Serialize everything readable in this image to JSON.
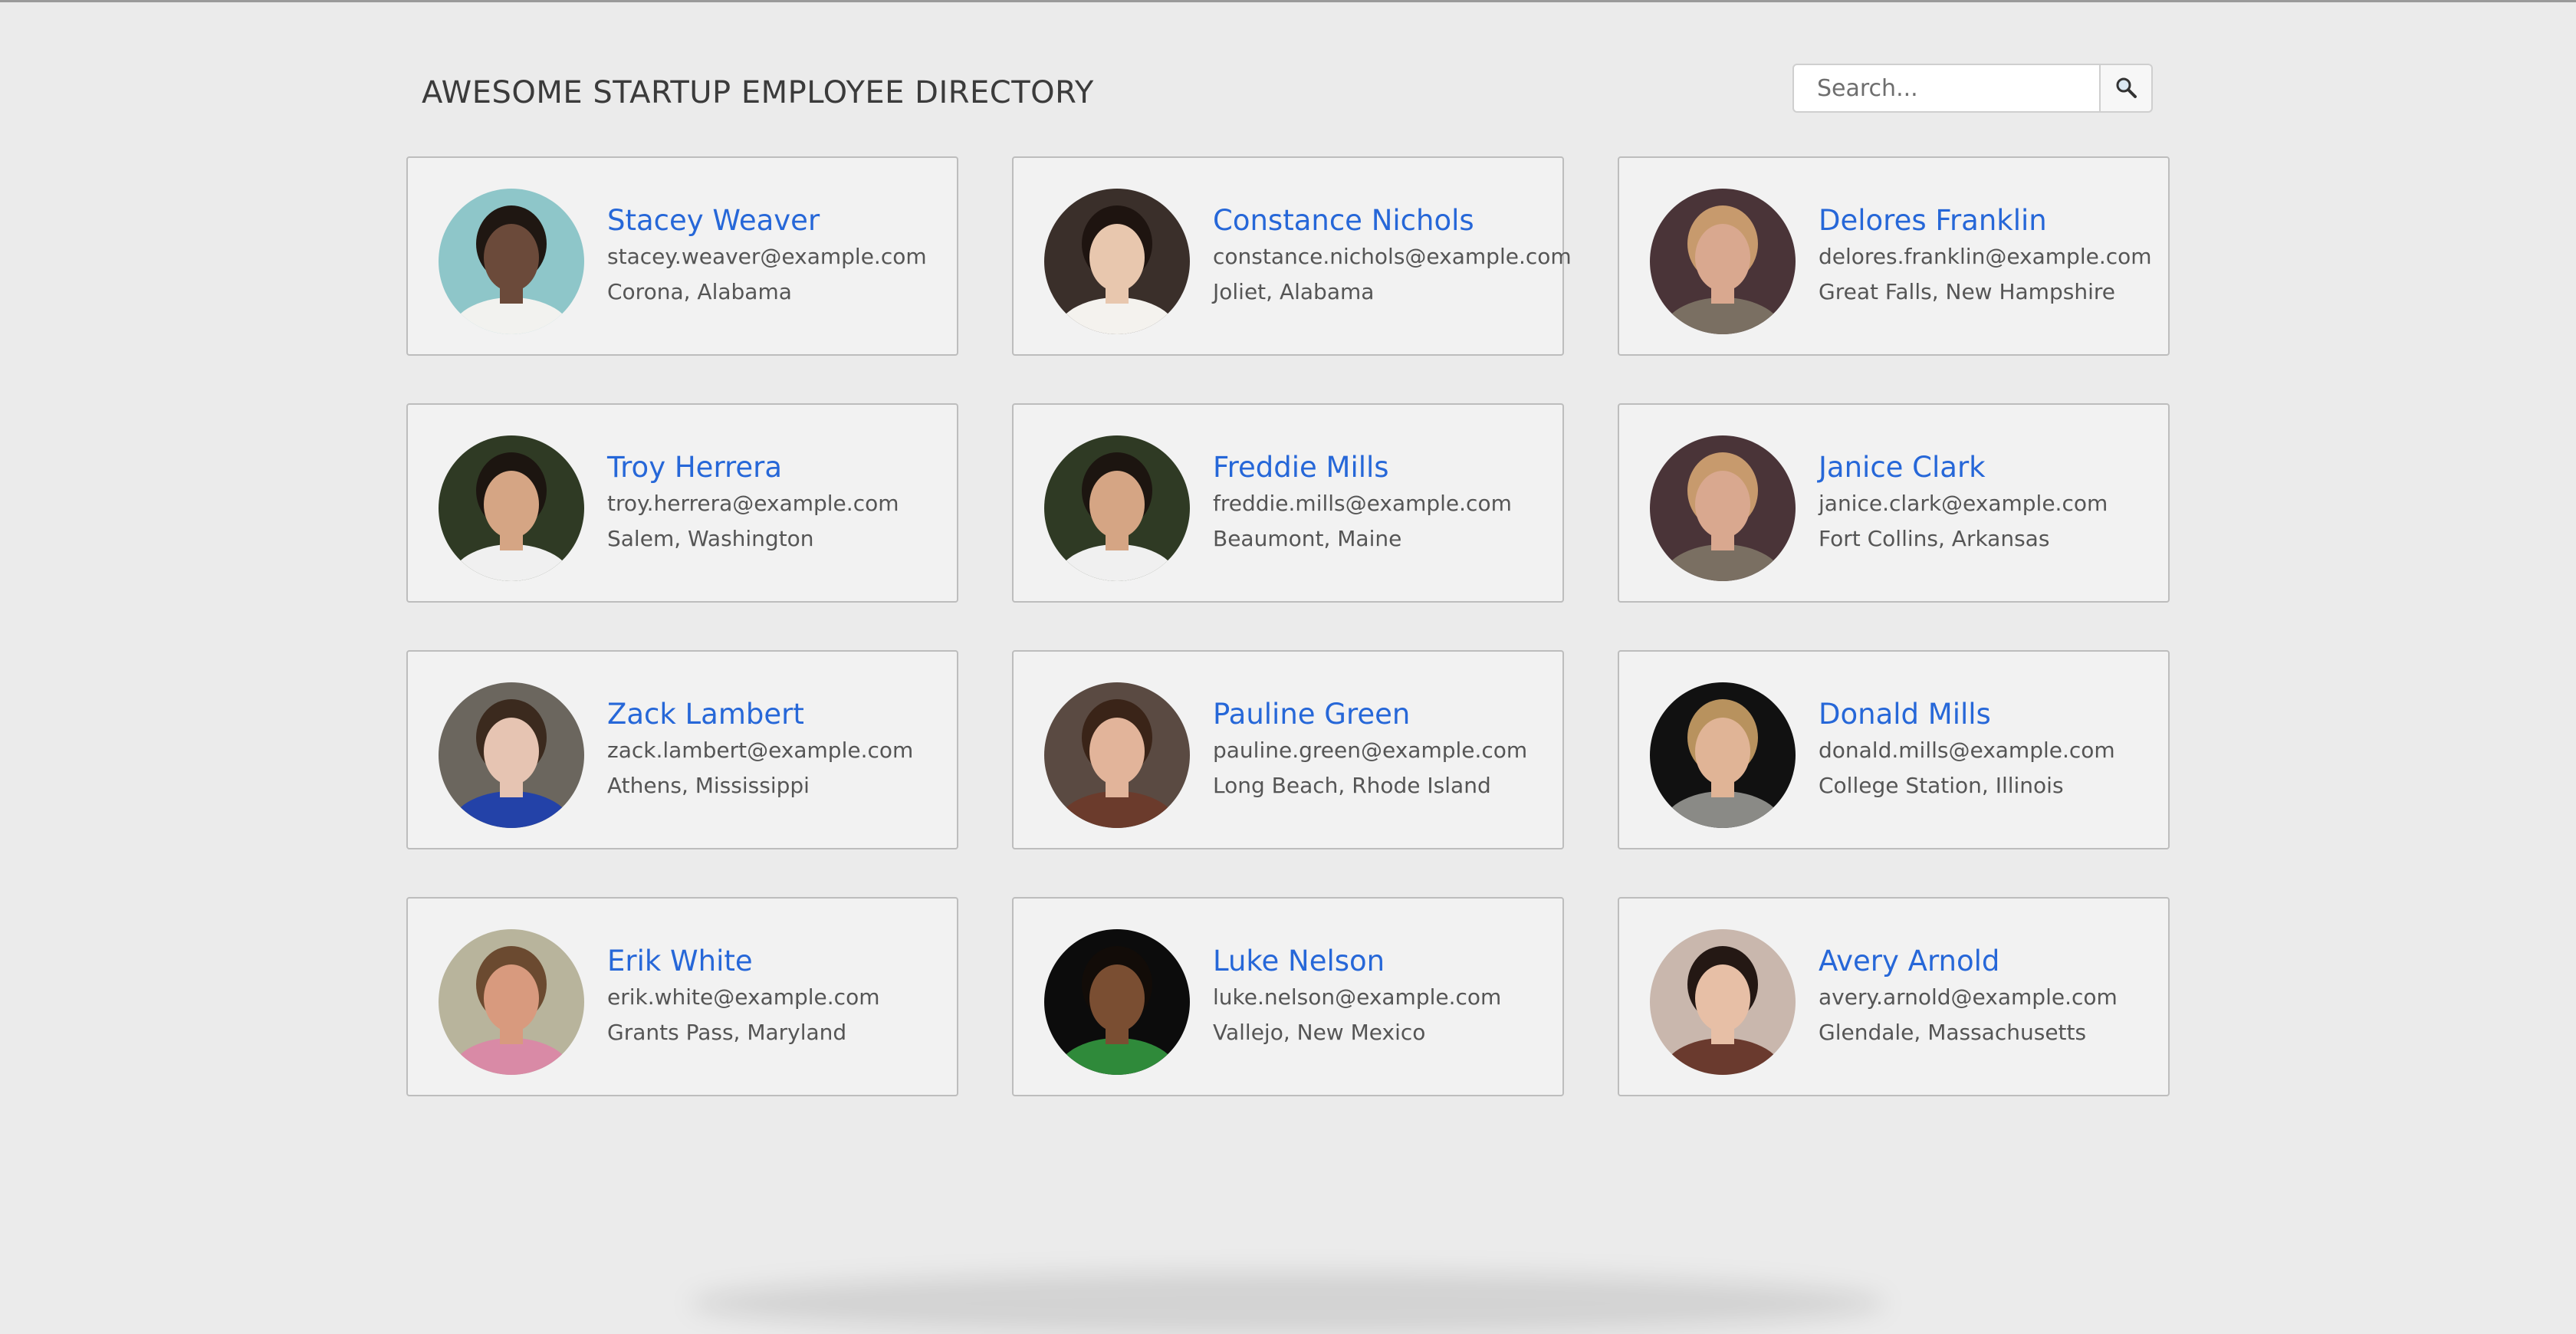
{
  "header": {
    "title": "AWESOME STARTUP EMPLOYEE DIRECTORY",
    "search": {
      "placeholder": "Search...",
      "value": "",
      "button_icon": "search-icon"
    }
  },
  "employees": [
    {
      "name": "Stacey Weaver",
      "email": "stacey.weaver@example.com",
      "location": "Corona, Alabama",
      "photo": {
        "bg": "#8ec6c9",
        "skin": "#6b4a3a",
        "hair": "#1f1712",
        "shirt": "#f2f2ef"
      }
    },
    {
      "name": "Constance Nichols",
      "email": "constance.nichols@example.com",
      "location": "Joliet, Alabama",
      "photo": {
        "bg": "#3a2f2a",
        "skin": "#e8c7ae",
        "hair": "#1e1410",
        "shirt": "#f4f2ee"
      }
    },
    {
      "name": "Delores Franklin",
      "email": "delores.franklin@example.com",
      "location": "Great Falls, New Hampshire",
      "photo": {
        "bg": "#4a3438",
        "skin": "#d9a88f",
        "hair": "#c79a6d",
        "shirt": "#7a6f62"
      }
    },
    {
      "name": "Troy Herrera",
      "email": "troy.herrera@example.com",
      "location": "Salem, Washington",
      "photo": {
        "bg": "#2f3a24",
        "skin": "#d5a584",
        "hair": "#1c1510",
        "shirt": "#f0f0f0"
      }
    },
    {
      "name": "Freddie Mills",
      "email": "freddie.mills@example.com",
      "location": "Beaumont, Maine",
      "photo": {
        "bg": "#2f3a24",
        "skin": "#d5a584",
        "hair": "#1c1510",
        "shirt": "#f0f0f0"
      }
    },
    {
      "name": "Janice Clark",
      "email": "janice.clark@example.com",
      "location": "Fort Collins, Arkansas",
      "photo": {
        "bg": "#4a3438",
        "skin": "#d9a88f",
        "hair": "#c79a6d",
        "shirt": "#7a6f62"
      }
    },
    {
      "name": "Zack Lambert",
      "email": "zack.lambert@example.com",
      "location": "Athens, Mississippi",
      "photo": {
        "bg": "#6b665e",
        "skin": "#e6c4b2",
        "hair": "#3b2a1e",
        "shirt": "#2342a8"
      }
    },
    {
      "name": "Pauline Green",
      "email": "pauline.green@example.com",
      "location": "Long Beach, Rhode Island",
      "photo": {
        "bg": "#5a4a42",
        "skin": "#e2b49a",
        "hair": "#3a2418",
        "shirt": "#6b3b2c"
      }
    },
    {
      "name": "Donald Mills",
      "email": "donald.mills@example.com",
      "location": "College Station, Illinois",
      "photo": {
        "bg": "#111111",
        "skin": "#e0b496",
        "hair": "#b8925e",
        "shirt": "#8a8a86"
      }
    },
    {
      "name": "Erik White",
      "email": "erik.white@example.com",
      "location": "Grants Pass, Maryland",
      "photo": {
        "bg": "#b8b49c",
        "skin": "#d89a7e",
        "hair": "#6b4a30",
        "shirt": "#d98aa6"
      }
    },
    {
      "name": "Luke Nelson",
      "email": "luke.nelson@example.com",
      "location": "Vallejo, New Mexico",
      "photo": {
        "bg": "#0c0c0c",
        "skin": "#7a4e32",
        "hair": "#120c08",
        "shirt": "#2f8a3a"
      }
    },
    {
      "name": "Avery Arnold",
      "email": "avery.arnold@example.com",
      "location": "Glendale, Massachusetts",
      "photo": {
        "bg": "#c9b7ad",
        "skin": "#e7bfa6",
        "hair": "#241814",
        "shirt": "#6a3a2e"
      }
    }
  ]
}
